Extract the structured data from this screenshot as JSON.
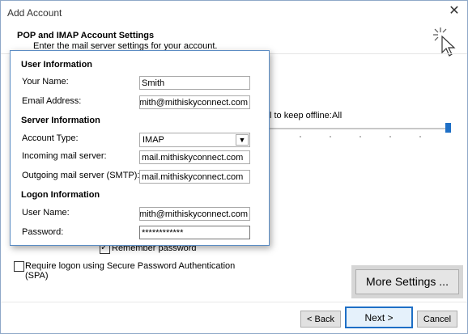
{
  "window": {
    "title": "Add Account",
    "close_symbol": "✕"
  },
  "header": {
    "title": "POP and IMAP Account Settings",
    "subtitle": "Enter the mail server settings for your account."
  },
  "background": {
    "keep_offline_label": "l to keep offline:",
    "keep_offline_value": "All",
    "remember_password_label": "Remember password",
    "remember_password_checked": true,
    "spa_label_line1": "Require logon using Secure Password Authentication",
    "spa_label_line2": "(SPA)",
    "spa_checked": false
  },
  "user_info": {
    "section": "User Information",
    "name_label": "Your Name:",
    "name_value": "Smith",
    "email_label": "Email Address:",
    "email_value": "smith@mithiskyconnect.com"
  },
  "server_info": {
    "section": "Server Information",
    "account_type_label": "Account Type:",
    "account_type_value": "IMAP",
    "incoming_label": "Incoming mail server:",
    "incoming_value": "mail.mithiskyconnect.com",
    "outgoing_label": "Outgoing mail server (SMTP):",
    "outgoing_value": "mail.mithiskyconnect.com"
  },
  "logon_info": {
    "section": "Logon Information",
    "username_label": "User Name:",
    "username_value": "smith@mithiskyconnect.com",
    "password_label": "Password:",
    "password_value": "************"
  },
  "buttons": {
    "more_settings": "More Settings ...",
    "back": "< Back",
    "next": "Next >",
    "cancel": "Cancel"
  },
  "colors": {
    "accent": "#1e6fc6",
    "popup_border": "#5b8cc3"
  }
}
